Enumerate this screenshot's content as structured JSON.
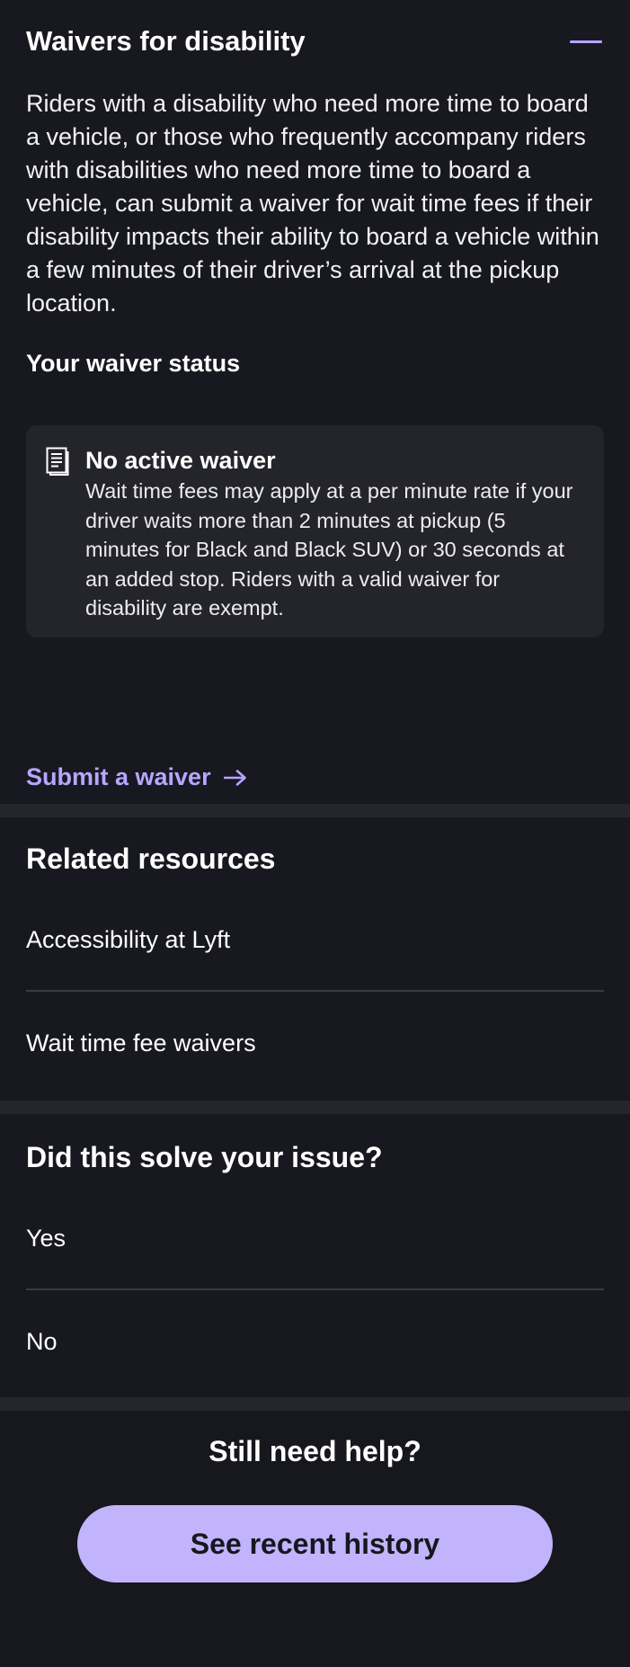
{
  "waiver": {
    "title": "Waivers for disability",
    "description": "Riders with a disability who need more time to board a vehicle, or those who frequently accompany riders with disabilities who need more time to board a vehicle, can submit a waiver for wait time fees if their disability impacts their ability to board a vehicle within a few minutes of their driver’s arrival at the pickup location.",
    "status_label": "Your waiver status",
    "card": {
      "icon": "document-icon",
      "title": "No active waiver",
      "text": "Wait time fees may apply at a per minute rate if your driver waits more than 2 minutes at pickup (5 minutes for Black and Black SUV) or 30 seconds at an added stop. Riders with a valid waiver for disability are exempt."
    },
    "submit_label": "Submit a waiver"
  },
  "related": {
    "heading": "Related resources",
    "items": [
      {
        "label": "Accessibility at Lyft"
      },
      {
        "label": "Wait time fee waivers"
      }
    ]
  },
  "solve": {
    "heading": "Did this solve your issue?",
    "options": [
      {
        "label": "Yes"
      },
      {
        "label": "No"
      }
    ]
  },
  "help": {
    "heading": "Still need help?",
    "button_label": "See recent history"
  },
  "colors": {
    "background": "#181820",
    "accent": "#b7a6ff",
    "button": "#c1b4fd",
    "card": "#24242b"
  }
}
